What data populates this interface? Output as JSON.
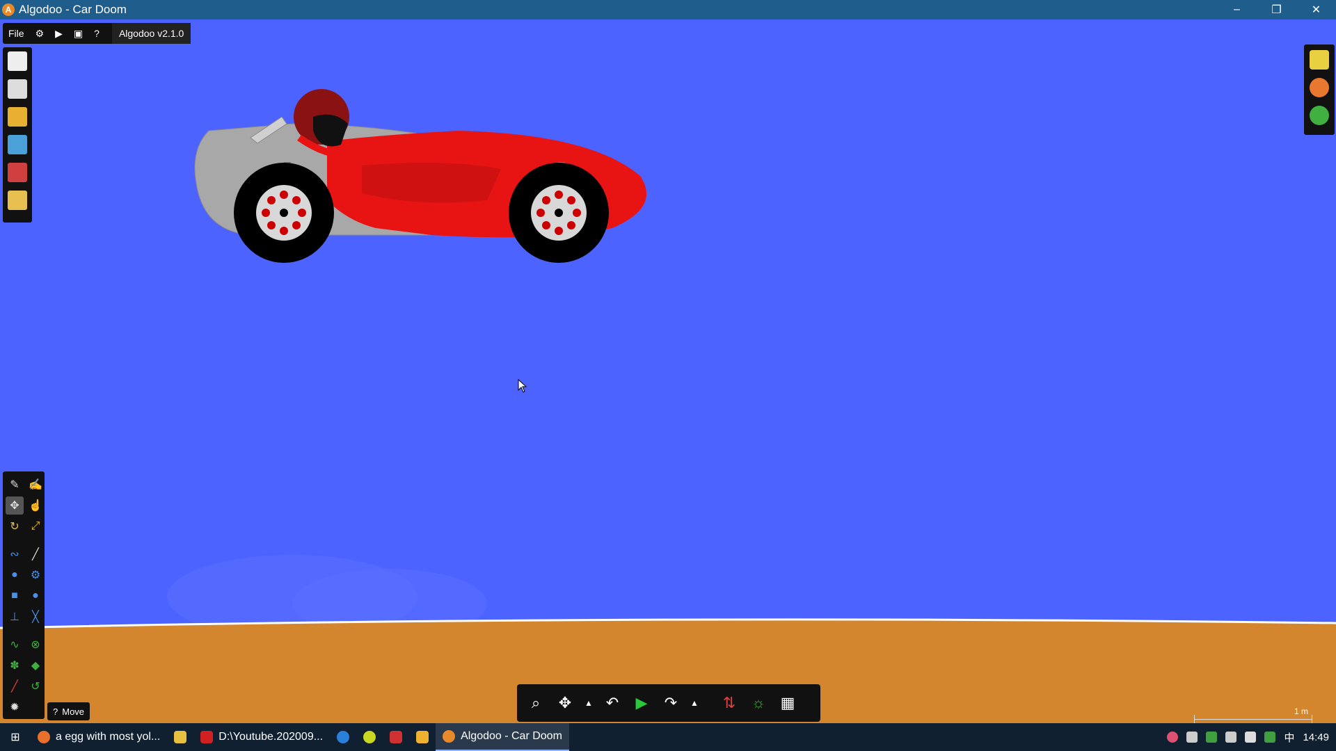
{
  "window": {
    "title": "Algodoo - Car Doom",
    "app_icon": "algodoo-icon",
    "controls": [
      "minimize-icon",
      "restore-icon",
      "close-icon"
    ]
  },
  "menu": {
    "file_label": "File",
    "icons": [
      "gear-icon",
      "play-screen-icon",
      "window-icon",
      "help-icon"
    ],
    "version": "Algodoo v2.1.0"
  },
  "file_toolbar": {
    "icons": [
      "new-scene-icon",
      "new-box-icon",
      "open-folder-icon",
      "algobox-icon",
      "export-icon",
      "import-icon"
    ]
  },
  "right_panel": {
    "icons": [
      "layers-icon",
      "palette-icon",
      "collection-icon"
    ]
  },
  "tools": {
    "items": [
      "sketch-icon",
      "brush-icon",
      "move-icon",
      "drag-icon",
      "rotate-icon",
      "scale-icon",
      "rope-icon",
      "knife-icon",
      "hinge-icon",
      "gear-icon",
      "box-icon",
      "circle-icon",
      "fixate-icon",
      "tracer-icon",
      "spring-icon",
      "axle-icon",
      "thruster-icon",
      "laser-icon",
      "pen-icon",
      "chain-icon",
      "zoom-tool-icon"
    ],
    "active": "Move"
  },
  "bottom_toolbar": {
    "icons": [
      "zoom-icon",
      "pan-icon",
      "up-arrow-icon",
      "undo-icon",
      "play-icon",
      "redo-icon",
      "up-arrow-icon-2",
      "gravity-icon",
      "air-icon",
      "grid-icon"
    ]
  },
  "scale_label": "1 m",
  "taskbar": {
    "tasks": [
      {
        "label": "a egg with most yol...",
        "icon": "firefox-icon"
      },
      {
        "label": "",
        "icon": "file-explorer-icon"
      },
      {
        "label": "D:\\Youtube.202009...",
        "icon": "pdf-icon"
      },
      {
        "label": "",
        "icon": "edge-icon"
      },
      {
        "label": "",
        "icon": "chat-icon"
      },
      {
        "label": "",
        "icon": "office-icon"
      },
      {
        "label": "",
        "icon": "note-icon"
      },
      {
        "label": "Algodoo - Car Doom",
        "icon": "algodoo-icon",
        "active": true
      }
    ],
    "tray_lang": "中",
    "time": "14:49"
  },
  "colors": {
    "sky": "#4c63ff",
    "ground": "#d4862e",
    "car_red": "#e81414",
    "car_grey": "#a8a8a8"
  }
}
